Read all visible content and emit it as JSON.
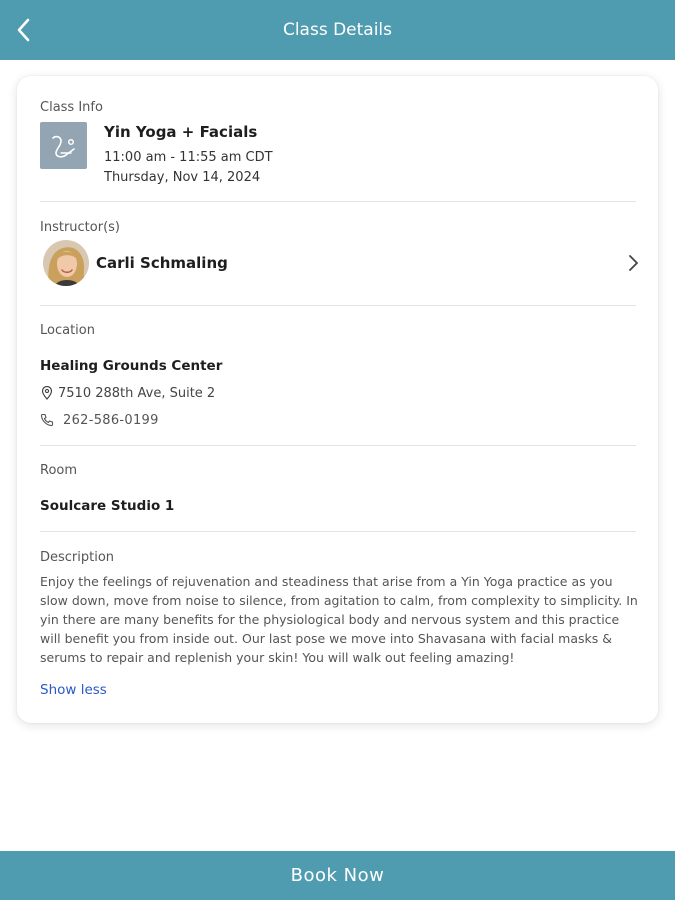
{
  "header": {
    "title": "Class Details",
    "back_icon": "chevron-left-icon"
  },
  "class_info": {
    "label": "Class Info",
    "name": "Yin Yoga + Facials",
    "time": "11:00 am - 11:55 am CDT",
    "date": "Thursday, Nov 14, 2024",
    "thumbnail_icon": "yoga-pose-icon"
  },
  "instructor": {
    "label": "Instructor(s)",
    "name": "Carli Schmaling",
    "chevron_icon": "chevron-right-icon"
  },
  "location": {
    "label": "Location",
    "name": "Healing Grounds Center",
    "address": "7510 288th Ave, Suite 2",
    "phone": "262-586-0199",
    "address_icon": "map-pin-icon",
    "phone_icon": "phone-icon"
  },
  "room": {
    "label": "Room",
    "name": "Soulcare Studio 1"
  },
  "description": {
    "label": "Description",
    "text": "Enjoy the feelings of rejuvenation and steadiness that arise from a Yin Yoga practice as you slow down, move from noise to silence, from agitation to calm, from complexity to simplicity. In yin there are many benefits for the physiological body and nervous system and this practice will benefit you from inside out. Our last pose we move into Shavasana with facial masks & serums to repair and replenish your skin! You will walk out feeling amazing!",
    "toggle_label": "Show less"
  },
  "footer": {
    "book_label": "Book Now"
  },
  "colors": {
    "accent": "#4f9cb0",
    "link": "#2a58c8",
    "thumbnail_bg": "#93a4b2"
  }
}
